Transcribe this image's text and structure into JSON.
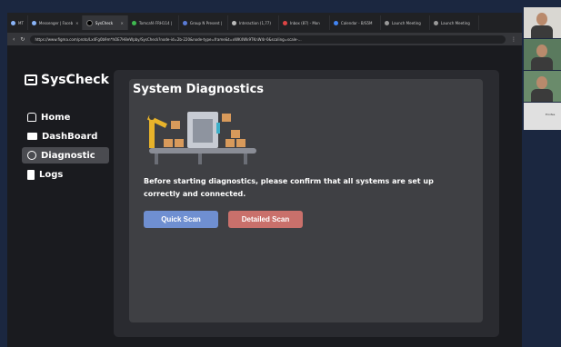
{
  "browser": {
    "tabs": [
      {
        "label": "MT",
        "active": false
      },
      {
        "label": "Messenger | Faceb",
        "active": false
      },
      {
        "label": "SysCheck",
        "active": true
      },
      {
        "label": "Tomcafé FRH114 |",
        "active": false
      },
      {
        "label": "Group N Present |",
        "active": false
      },
      {
        "label": "Interaction (1,77)",
        "active": false
      },
      {
        "label": "Inbox (87) - Mon",
        "active": false
      },
      {
        "label": "Calendar - B/S5M",
        "active": false
      },
      {
        "label": "Launch Meeting",
        "active": false
      },
      {
        "label": "Launch Meeting",
        "active": false
      }
    ],
    "url": "https://www.figma.com/proto/Lx4Fg0b9m*hOE7H8eWpby/SysCheck?node-id=2b-220&node-type=frame&t=xWK4Wk9TKnW4r-0&scaling=scale-..."
  },
  "app": {
    "logo_text": "SysCheck",
    "nav": [
      {
        "label": "Home",
        "icon": "home-icon"
      },
      {
        "label": "DashBoard",
        "icon": "dashboard-icon"
      },
      {
        "label": "Diagnostic",
        "icon": "diagnostic-icon"
      },
      {
        "label": "Logs",
        "icon": "logs-icon"
      }
    ],
    "active_nav": "Diagnostic"
  },
  "main": {
    "title": "System Diagnostics",
    "message": "Before starting diagnostics, please confirm that all systems are set up correctly and connected.",
    "quick_scan_label": "Quick Scan",
    "detailed_scan_label": "Detailed Scan"
  },
  "participants": [
    {
      "label": ""
    },
    {
      "label": ""
    },
    {
      "label": ""
    },
    {
      "label": "Ernđes"
    }
  ],
  "colors": {
    "quick_scan": "#6f8fd1",
    "detailed_scan": "#c9706b",
    "panel": "#3f4044",
    "active_nav": "#4a4b50"
  }
}
